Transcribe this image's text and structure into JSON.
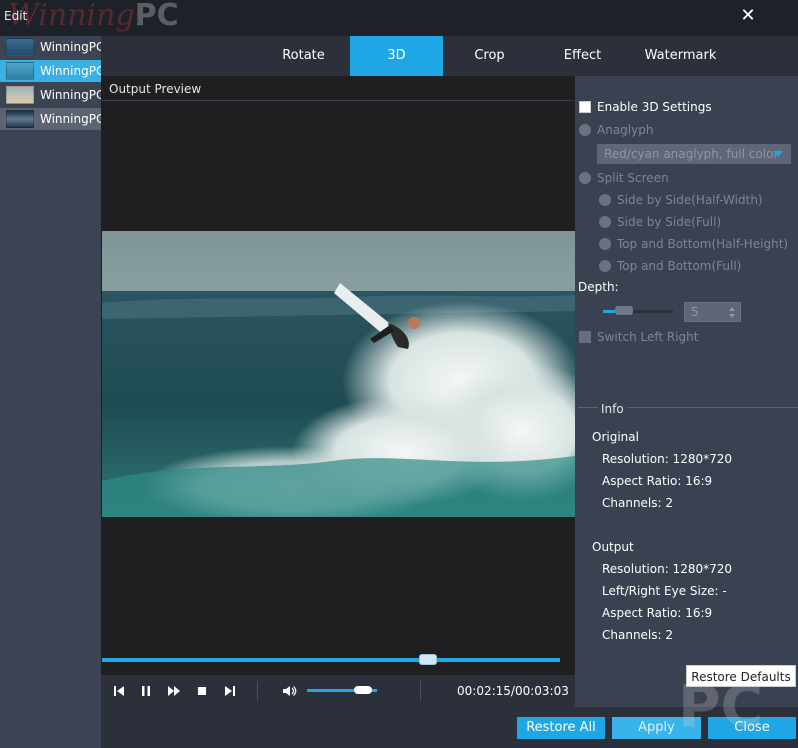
{
  "window": {
    "title": "Edit",
    "logo": "Winning",
    "logo_pc": "PC",
    "watermark": "PC"
  },
  "files": [
    {
      "name": "WinningPC",
      "state": "normal",
      "thumb": "t1"
    },
    {
      "name": "WinningPC",
      "state": "selected",
      "thumb": "t2"
    },
    {
      "name": "WinningPC",
      "state": "normal",
      "thumb": "t3"
    },
    {
      "name": "WinningPC",
      "state": "hover",
      "thumb": "t4"
    }
  ],
  "tabs": [
    {
      "label": "Rotate"
    },
    {
      "label": "3D",
      "active": true
    },
    {
      "label": "Crop"
    },
    {
      "label": "Effect"
    },
    {
      "label": "Watermark"
    }
  ],
  "preview": {
    "label": "Output Preview",
    "progress_percent": 72,
    "volume_percent": 90
  },
  "player": {
    "time": "00:02:15/00:03:03"
  },
  "settings3d": {
    "enable_label": "Enable 3D Settings",
    "enabled": false,
    "anaglyph_label": "Anaglyph",
    "anaglyph_value": "Red/cyan anaglyph, full color",
    "split_label": "Split Screen",
    "split_options": [
      "Side by Side(Half-Width)",
      "Side by Side(Full)",
      "Top and Bottom(Half-Height)",
      "Top and Bottom(Full)"
    ],
    "depth_label": "Depth:",
    "depth_value": "5",
    "switch_label": "Switch Left Right"
  },
  "info": {
    "title": "Info",
    "original_title": "Original",
    "original": [
      "Resolution: 1280*720",
      "Aspect Ratio: 16:9",
      "Channels: 2"
    ],
    "output_title": "Output",
    "output": [
      "Resolution: 1280*720",
      "Left/Right Eye Size: -",
      "Aspect Ratio: 16:9",
      "Channels: 2"
    ]
  },
  "buttons": {
    "restore_defaults": "Restore Defaults",
    "restore_all": "Restore All",
    "apply": "Apply",
    "close": "Close"
  },
  "colors": {
    "accent": "#1ea7e4",
    "panel": "#3a4150",
    "dark": "#2b303b"
  }
}
